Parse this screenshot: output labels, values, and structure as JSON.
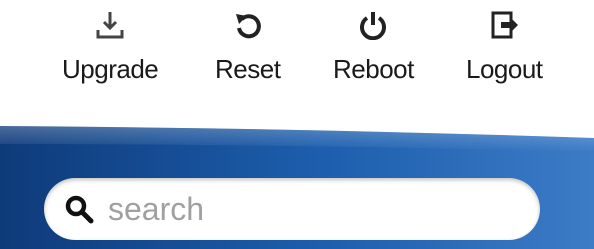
{
  "toolbar": {
    "items": [
      {
        "label": "Upgrade",
        "icon": "upgrade-icon"
      },
      {
        "label": "Reset",
        "icon": "reset-icon"
      },
      {
        "label": "Reboot",
        "icon": "power-icon"
      },
      {
        "label": "Logout",
        "icon": "logout-icon"
      }
    ]
  },
  "search": {
    "placeholder": "search",
    "value": "",
    "icon": "search-icon"
  },
  "colors": {
    "banner_dark": "#0e3a7a",
    "banner_mid": "#1d5fae",
    "banner_light": "#3c7bc6",
    "text": "#1a1a1a",
    "placeholder": "#a0a0a0"
  }
}
